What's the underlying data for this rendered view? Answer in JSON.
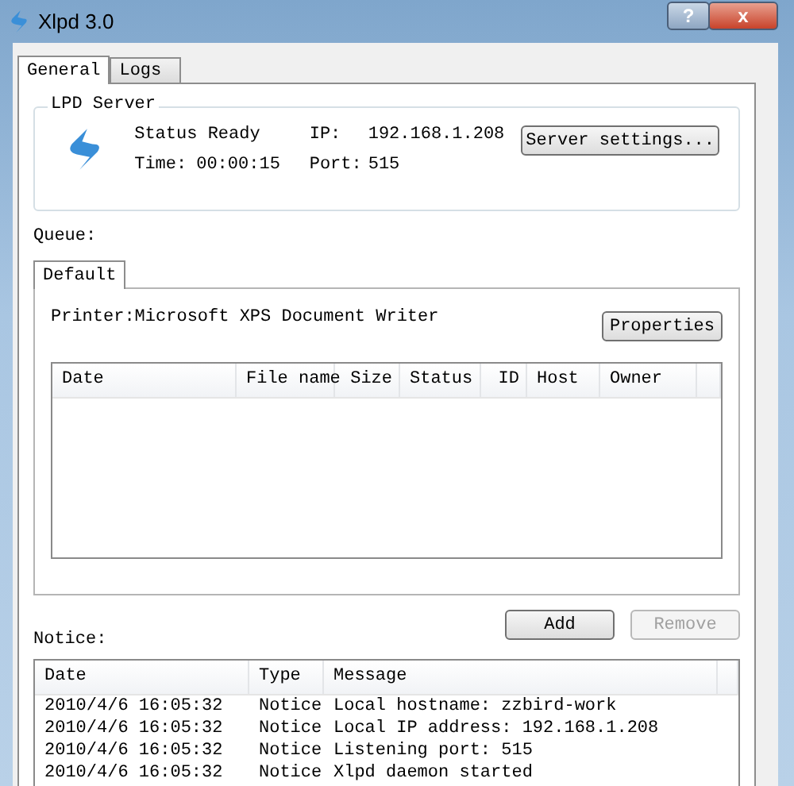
{
  "window": {
    "title": "Xlpd 3.0",
    "help_button": "?",
    "close_button": "x"
  },
  "tabs": [
    {
      "label": "General",
      "selected": true
    },
    {
      "label": "Logs",
      "selected": false
    }
  ],
  "lpd_server": {
    "title": "LPD Server",
    "status": "Status Ready",
    "time_label": "Time:",
    "time": "00:00:15",
    "ip_label": "IP:",
    "ip": "192.168.1.208",
    "port_label": "Port:",
    "port": "515",
    "settings_button": "Server settings..."
  },
  "queue": {
    "label": "Queue:",
    "tabs": [
      {
        "label": "Default",
        "selected": true
      }
    ],
    "printer": "Printer:Microsoft XPS Document Writer",
    "properties_button": "Properties",
    "columns": [
      "Date",
      "File name",
      "Size",
      "Status",
      "ID",
      "Host",
      "Owner"
    ],
    "buttons": [
      {
        "label": "Add",
        "disabled": false
      },
      {
        "label": "Remove",
        "disabled": true
      }
    ]
  },
  "notice": {
    "label": "Notice:",
    "columns": [
      "Date",
      "Type",
      "Message"
    ],
    "rows": [
      {
        "date": "2010/4/6 16:05:32",
        "type": "Notice",
        "message": "Local hostname: zzbird-work"
      },
      {
        "date": "2010/4/6 16:05:32",
        "type": "Notice",
        "message": "Local IP address: 192.168.1.208"
      },
      {
        "date": "2010/4/6 16:05:32",
        "type": "Notice",
        "message": "Listening port: 515"
      },
      {
        "date": "2010/4/6 16:05:32",
        "type": "Notice",
        "message": "Xlpd daemon started"
      }
    ]
  }
}
